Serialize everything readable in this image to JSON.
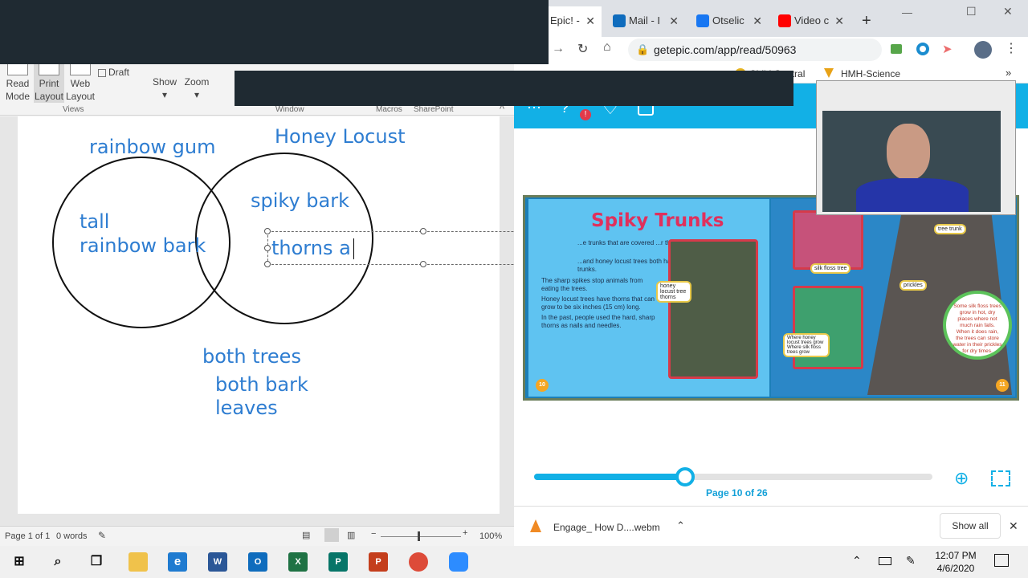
{
  "word": {
    "ribbon": {
      "read_mode": "Read\nMode",
      "print_layout": "Print\nLayout",
      "web_layout": "Web\nLayout",
      "draft": "Draft",
      "show": "Show",
      "zoom": "Zoom",
      "group_views": "Views",
      "group_window": "Window",
      "group_macros": "Macros",
      "group_sharepoint": "SharePoint"
    },
    "doc": {
      "label_rainbow_gum": "rainbow gum",
      "label_honey_locust": "Honey Locust",
      "left_line1": "tall",
      "left_line2": "rainbow bark",
      "right_line1": "spiky bark",
      "textbox_text": "thorns a",
      "below_line1": "both trees",
      "below_line2": "both bark",
      "below_line3": "leaves"
    },
    "status": {
      "page": "Page 1 of 1",
      "words": "0 words",
      "zoom": "100%"
    }
  },
  "chrome": {
    "tabs": [
      {
        "label": "Epic! -",
        "color": "#2bb5e8"
      },
      {
        "label": "Mail - I",
        "color": "#0f6cbd"
      },
      {
        "label": "Otselic",
        "color": "#1877f2"
      },
      {
        "label": "Video c",
        "color": "#ff0000"
      }
    ],
    "new_tab": "+",
    "url": "getepic.com/app/read/50963",
    "bookmarks": {
      "child_central": "Child Central",
      "hmh": "HMH-Science"
    }
  },
  "book": {
    "title": "Spiky Trunks",
    "para1": "...e trunks that are covered ...r thorns.",
    "para2": "...and honey locust trees both have spiky trunks.",
    "para3": "The sharp spikes stop animals from eating the trees.",
    "para4": "Honey locust trees have thorns that can grow to be six inches (15 cm) long.",
    "para5": "In the past, people used the hard, sharp thorns as nails and needles.",
    "label_thorns": "honey locust tree thorns",
    "label_silk_floss": "silk floss tree",
    "label_prickles": "prickles",
    "label_tree_trunk": "tree trunk",
    "legend_honey": "Where honey locust trees grow",
    "legend_silk": "Where silk floss trees grow",
    "bubble_text": "Some silk floss trees grow in hot, dry places where not much rain falls. When it does rain, the trees can store water in their prickles for dry times.",
    "page_left": "10",
    "page_right": "11"
  },
  "reader": {
    "progress": 0.38,
    "page_indicator": "Page 10 of 26"
  },
  "downloads": {
    "file": "Engage_ How D....webm",
    "show_all": "Show all"
  },
  "taskbar": {
    "time": "12:07 PM",
    "date": "4/6/2020"
  }
}
